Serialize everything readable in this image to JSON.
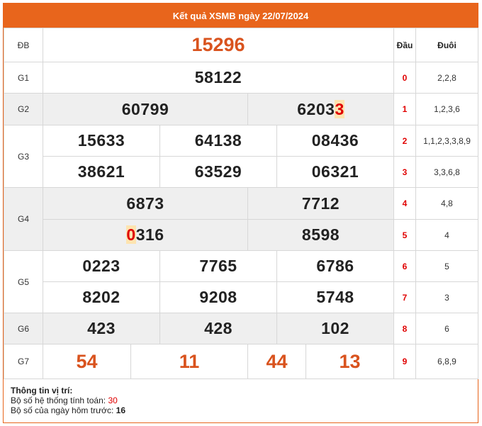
{
  "title": "Kết quả XSMB ngày 22/07/2024",
  "headers": {
    "dau": "Đầu",
    "duoi": "Đuôi"
  },
  "labels": {
    "db": "ĐB",
    "g1": "G1",
    "g2": "G2",
    "g3": "G3",
    "g4": "G4",
    "g5": "G5",
    "g6": "G6",
    "g7": "G7"
  },
  "prizes": {
    "db": "15296",
    "g1": "58122",
    "g2": [
      {
        "pre": "6079",
        "hl": "",
        "post": "9"
      },
      {
        "pre": "6203",
        "hl": "3",
        "post": ""
      }
    ],
    "g3": [
      "15633",
      "64138",
      "08436",
      "38621",
      "63529",
      "06321"
    ],
    "g4": [
      {
        "pre": "",
        "hl": "",
        "post": "6873"
      },
      {
        "pre": "",
        "hl": "",
        "post": "7712"
      },
      {
        "pre": "",
        "hl": "0",
        "post": "316"
      },
      {
        "pre": "",
        "hl": "",
        "post": "8598"
      }
    ],
    "g5": [
      "0223",
      "7765",
      "6786",
      "8202",
      "9208",
      "5748"
    ],
    "g6": [
      "423",
      "428",
      "102"
    ],
    "g7": [
      "54",
      "11",
      "44",
      "13"
    ]
  },
  "dau_duoi": [
    {
      "dau": "0",
      "duoi": "2,2,8"
    },
    {
      "dau": "1",
      "duoi": "1,2,3,6"
    },
    {
      "dau": "2",
      "duoi": "1,1,2,3,3,8,9"
    },
    {
      "dau": "3",
      "duoi": "3,3,6,8"
    },
    {
      "dau": "4",
      "duoi": "4,8"
    },
    {
      "dau": "5",
      "duoi": "4"
    },
    {
      "dau": "6",
      "duoi": "5"
    },
    {
      "dau": "7",
      "duoi": "3"
    },
    {
      "dau": "8",
      "duoi": "6"
    },
    {
      "dau": "9",
      "duoi": "6,8,9"
    }
  ],
  "info": {
    "title": "Thông tin vị trí:",
    "line1_label": "Bộ số hệ thống tính toán: ",
    "line1_value": "30",
    "line2_label": "Bộ số của ngày hôm trước: ",
    "line2_value": "16"
  },
  "colors": {
    "accent": "#e8651c",
    "highlight": "#e00000",
    "prize_orange": "#d9531e"
  }
}
